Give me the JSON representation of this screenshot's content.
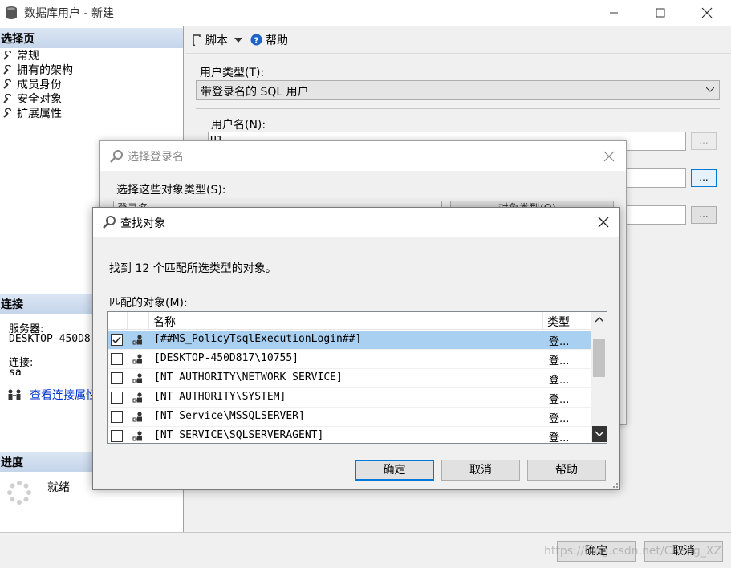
{
  "main_window": {
    "title": "数据库用户 - 新建",
    "left_pane": {
      "select_page_header": "选择页",
      "pages": [
        "常规",
        "拥有的架构",
        "成员身份",
        "安全对象",
        "扩展属性"
      ],
      "connection_header": "连接",
      "server_label": "服务器:",
      "server_value": "DESKTOP-450D8",
      "connection_label": "连接:",
      "connection_value": "sa",
      "view_connection_link": "查看连接属性",
      "progress_header": "进度",
      "progress_status": "就绪"
    },
    "toolbar": {
      "script_label": "脚本",
      "help_label": "帮助"
    },
    "form": {
      "user_type_label": "用户类型(T):",
      "user_type_value": "带登录名的 SQL 用户",
      "username_label": "用户名(N):",
      "username_value": "U1",
      "browse_button": "..."
    },
    "bottom_buttons": {
      "ok": "确定",
      "cancel": "取消"
    },
    "watermark": "https://blog.csdn.net/Cheng_XZ"
  },
  "login_dialog": {
    "title": "选择登录名",
    "object_types_label": "选择这些对象类型(S):",
    "object_types_value": "登录名",
    "object_types_button": "对象类型(O)..."
  },
  "find_dialog": {
    "title": "查找对象",
    "found_message": "找到 12 个匹配所选类型的对象。",
    "matched_label": "匹配的对象(M):",
    "columns": {
      "name": "名称",
      "type": "类型"
    },
    "rows": [
      {
        "name": "[##MS_PolicyTsqlExecutionLogin##]",
        "type": "登...",
        "checked": true,
        "selected": true
      },
      {
        "name": "[DESKTOP-450D817\\10755]",
        "type": "登...",
        "checked": false,
        "selected": false
      },
      {
        "name": "[NT AUTHORITY\\NETWORK SERVICE]",
        "type": "登...",
        "checked": false,
        "selected": false
      },
      {
        "name": "[NT AUTHORITY\\SYSTEM]",
        "type": "登...",
        "checked": false,
        "selected": false
      },
      {
        "name": "[NT Service\\MSSQLSERVER]",
        "type": "登...",
        "checked": false,
        "selected": false
      },
      {
        "name": "[NT SERVICE\\SQLSERVERAGENT]",
        "type": "登...",
        "checked": false,
        "selected": false
      }
    ],
    "buttons": {
      "ok": "确定",
      "cancel": "取消",
      "help": "帮助"
    }
  },
  "colors": {
    "accent": "#0078d7",
    "selection": "#a9d0f0",
    "header_gradient": "#c5d5ea",
    "link": "#0033cc"
  }
}
